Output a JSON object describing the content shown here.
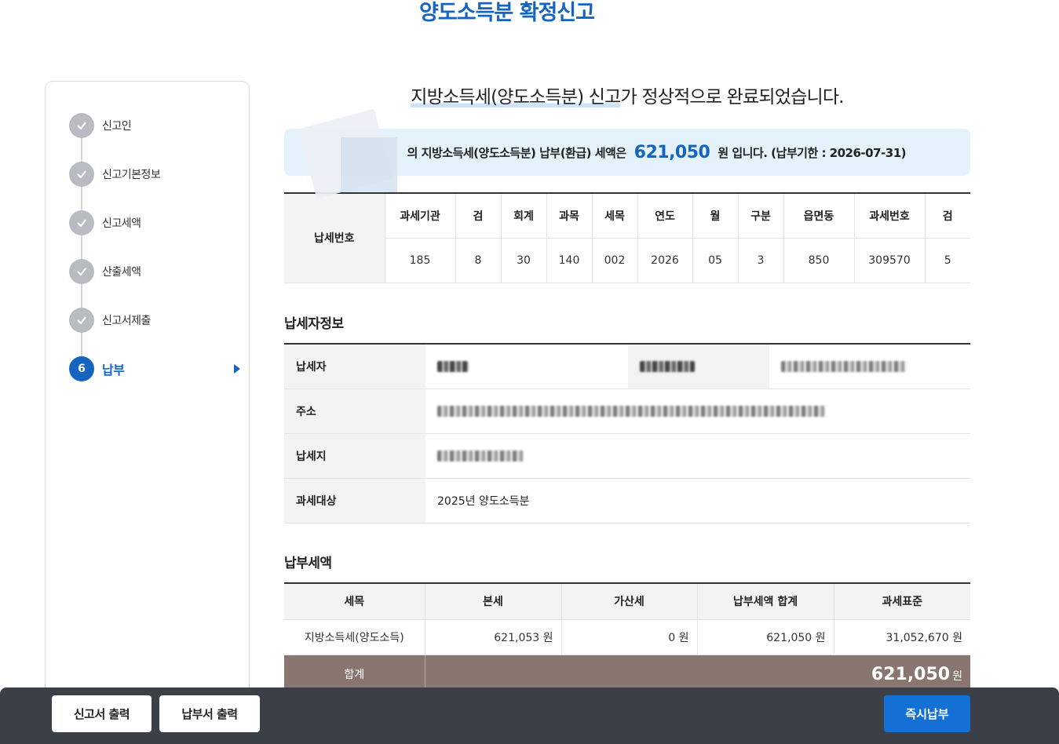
{
  "page": {
    "title": "양도소득분 확정신고"
  },
  "sidebar": {
    "steps": [
      {
        "label": "신고인",
        "state": "done"
      },
      {
        "label": "신고기본정보",
        "state": "done"
      },
      {
        "label": "신고세액",
        "state": "done"
      },
      {
        "label": "산출세액",
        "state": "done"
      },
      {
        "label": "신고서제출",
        "state": "done"
      },
      {
        "label": "납부",
        "number": "6",
        "state": "active"
      }
    ]
  },
  "main": {
    "complete_message_part1": "지방소득세(양도소득분) 신고",
    "complete_message_part2": "가 정상적으로 완료되었습니다.",
    "notice": {
      "prefix": "의 지방소득세(양도소득분) 납부(환급) 세액은",
      "amount": "621,050",
      "suffix": "원 입니다. (납부기한 : 2026-07-31)"
    },
    "tax_number": {
      "row_header": "납세번호",
      "columns": [
        "과세기관",
        "검",
        "회계",
        "과목",
        "세목",
        "연도",
        "월",
        "구분",
        "읍면동",
        "과세번호",
        "검"
      ],
      "values": [
        "185",
        "8",
        "30",
        "140",
        "002",
        "2026",
        "05",
        "3",
        "850",
        "309570",
        "5"
      ]
    },
    "taxpayer_section_title": "납세자정보",
    "taxpayer": {
      "taxpayer_label": "납세자",
      "address_label": "주소",
      "tax_location_label": "납세지",
      "tax_target_label": "과세대상",
      "tax_target_value": "2025년 양도소득분"
    },
    "amount_section_title": "납부세액",
    "amount_table": {
      "headers": [
        "세목",
        "본세",
        "가산세",
        "납부세액 합계",
        "과세표준"
      ],
      "row": [
        "지방소득세(양도소득)",
        "621,053 원",
        "0 원",
        "621,050 원",
        "31,052,670 원"
      ],
      "total_label": "합계",
      "total_value": "621,050",
      "total_unit": "원"
    }
  },
  "bottom_bar": {
    "print_report_label": "신고서 출력",
    "print_payment_label": "납부서 출력",
    "pay_now_label": "즉시납부"
  },
  "colors": {
    "accent": "#1565c0",
    "notice_bg": "#e4f2fc",
    "total_bg": "#8a7670",
    "bottom_bar": "#3b3f48"
  }
}
